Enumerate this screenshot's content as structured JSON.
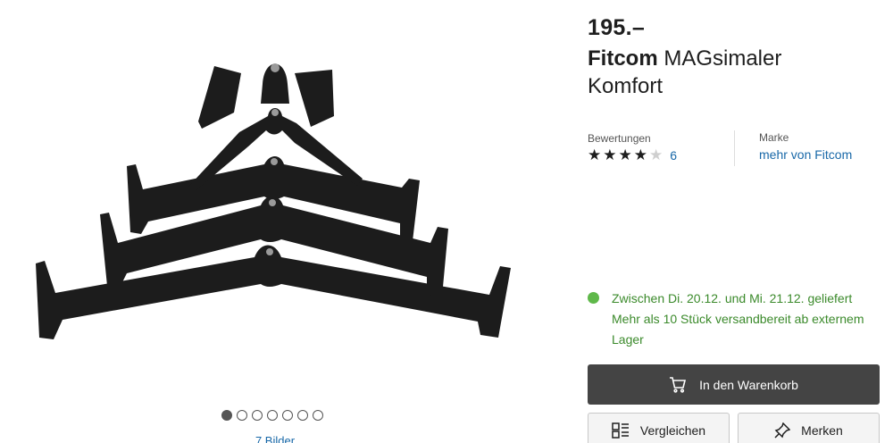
{
  "product": {
    "price": "195.–",
    "brand": "Fitcom",
    "name": "MAGsimaler Komfort"
  },
  "gallery": {
    "image_alt": "Fitcom MAGsimaler Komfort",
    "image_count_label": "7 Bilder",
    "dot_count": 7,
    "active_dot": 1
  },
  "ratings": {
    "label": "Bewertungen",
    "stars_filled": 4,
    "stars_total": 5,
    "count": "6"
  },
  "brand_info": {
    "label": "Marke",
    "link": "mehr von Fitcom"
  },
  "delivery": {
    "status_color": "#5fb84a",
    "line1": "Zwischen Di. 20.12. und Mi. 21.12. geliefert",
    "line2": "Mehr als 10 Stück versandbereit ab externem Lager"
  },
  "actions": {
    "cart": "In den Warenkorb",
    "compare": "Vergleichen",
    "notes": "Merken"
  },
  "colors": {
    "link": "#1868a8",
    "delivery_text": "#3b8a2b",
    "primary_button": "#444444"
  }
}
